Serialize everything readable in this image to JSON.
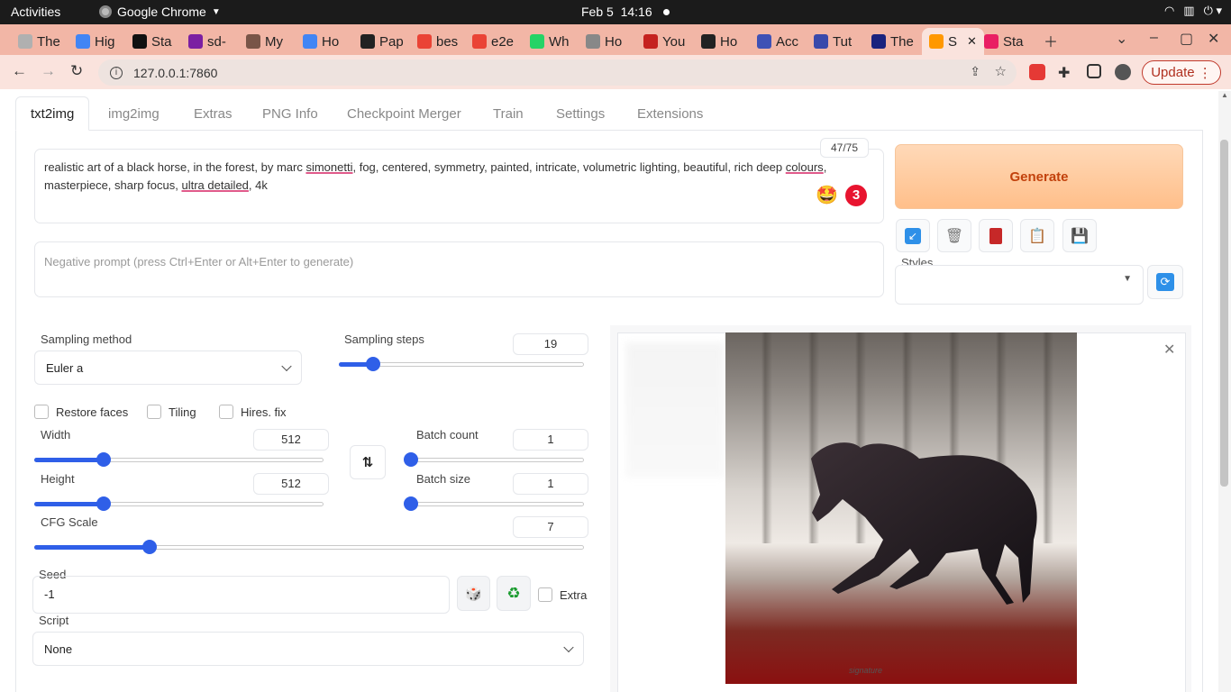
{
  "system": {
    "activities": "Activities",
    "app_name": "Google Chrome",
    "date": "Feb 5",
    "time": "14:16"
  },
  "browser": {
    "tabs": [
      {
        "label": "The",
        "color": "#b0b0b0"
      },
      {
        "label": "Hig",
        "color": "#4285f4"
      },
      {
        "label": "Sta",
        "color": "#111111"
      },
      {
        "label": "sd-",
        "color": "#7b1fa2"
      },
      {
        "label": "My",
        "color": "#795548"
      },
      {
        "label": "Ho",
        "color": "#4285f4"
      },
      {
        "label": "Pap",
        "color": "#222222"
      },
      {
        "label": "bes",
        "color": "#ea4335"
      },
      {
        "label": "e2e",
        "color": "#ea4335"
      },
      {
        "label": "Wh",
        "color": "#25d366"
      },
      {
        "label": "Ho",
        "color": "#888888"
      },
      {
        "label": "You",
        "color": "#c5221f"
      },
      {
        "label": "Ho",
        "color": "#222222"
      },
      {
        "label": "Acc",
        "color": "#3f51b5"
      },
      {
        "label": "Tut",
        "color": "#3949ab"
      },
      {
        "label": "The",
        "color": "#1a237e"
      },
      {
        "label": "S",
        "color": "#ff9800",
        "active": true
      },
      {
        "label": "Sta",
        "color": "#e91e63"
      }
    ],
    "url": "127.0.0.1:7860",
    "update_label": "Update"
  },
  "nav_tabs": [
    "txt2img",
    "img2img",
    "Extras",
    "PNG Info",
    "Checkpoint Merger",
    "Train",
    "Settings",
    "Extensions"
  ],
  "prompt": {
    "text_a": "realistic art of a black horse, in the forest, by marc ",
    "text_b": "simonetti",
    "text_c": ", fog, centered, symmetry, painted, intricate, volumetric lighting, beautiful, rich deep ",
    "text_d": "colours",
    "text_e": ",",
    "text_f": "masterpiece, sharp focus, ",
    "text_g": "ultra detailed",
    "text_h": ", 4k",
    "token_count": "47/75",
    "badge": "3",
    "negative_placeholder": "Negative prompt (press Ctrl+Enter or Alt+Enter to generate)"
  },
  "actions": {
    "generate": "Generate",
    "styles_label": "Styles"
  },
  "params": {
    "sampling_method_label": "Sampling method",
    "sampling_method": "Euler a",
    "sampling_steps_label": "Sampling steps",
    "sampling_steps": "19",
    "restore_faces": "Restore faces",
    "tiling": "Tiling",
    "hires_fix": "Hires. fix",
    "width_label": "Width",
    "width": "512",
    "height_label": "Height",
    "height": "512",
    "batch_count_label": "Batch count",
    "batch_count": "1",
    "batch_size_label": "Batch size",
    "batch_size": "1",
    "cfg_label": "CFG Scale",
    "cfg": "7",
    "seed_label": "Seed",
    "seed": "-1",
    "extra": "Extra",
    "script_label": "Script",
    "script": "None"
  },
  "slider_levels": {
    "sampling_steps": 0.14,
    "width": 0.24,
    "height": 0.24,
    "batch_count": 0.0,
    "batch_size": 0.0,
    "cfg": 0.21
  },
  "colors": {
    "accent": "#2f5fe8",
    "generate_text": "#c2410c",
    "tab_strip": "#f2b6a6"
  }
}
